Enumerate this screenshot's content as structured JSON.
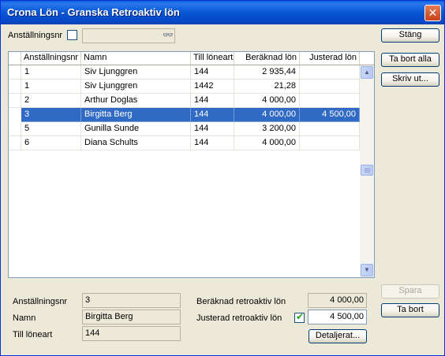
{
  "window": {
    "title": "Crona Lön - Granska Retroaktiv lön"
  },
  "filter": {
    "label": "Anställningsnr",
    "search_value": ""
  },
  "buttons": {
    "close": "Stäng",
    "delete_all": "Ta bort alla",
    "print": "Skriv ut...",
    "save": "Spara",
    "delete": "Ta bort",
    "details": "Detaljerat..."
  },
  "grid": {
    "columns": [
      "Anställningsnr",
      "Namn",
      "Till löneart",
      "Beräknad lön",
      "Justerad lön"
    ],
    "rows": [
      [
        "1",
        "Siv Ljunggren",
        "144",
        "2 935,44",
        ""
      ],
      [
        "1",
        "Siv Ljunggren",
        "1442",
        "21,28",
        ""
      ],
      [
        "2",
        "Arthur Doglas",
        "144",
        "4 000,00",
        ""
      ],
      [
        "3",
        "Birgitta Berg",
        "144",
        "4 000,00",
        "4 500,00"
      ],
      [
        "5",
        "Gunilla Sunde",
        "144",
        "3 200,00",
        ""
      ],
      [
        "6",
        "Diana Schults",
        "144",
        "4 000,00",
        ""
      ]
    ],
    "selected_index": 3
  },
  "detail": {
    "emp_label": "Anställningsnr",
    "emp_value": "3",
    "name_label": "Namn",
    "name_value": "Birgitta Berg",
    "wage_label": "Till löneart",
    "wage_value": "144",
    "calc_label": "Beräknad retroaktiv lön",
    "calc_value": "4 000,00",
    "adj_label": "Justerad retroaktiv lön",
    "adj_value": "4 500,00",
    "adj_checked": true
  }
}
